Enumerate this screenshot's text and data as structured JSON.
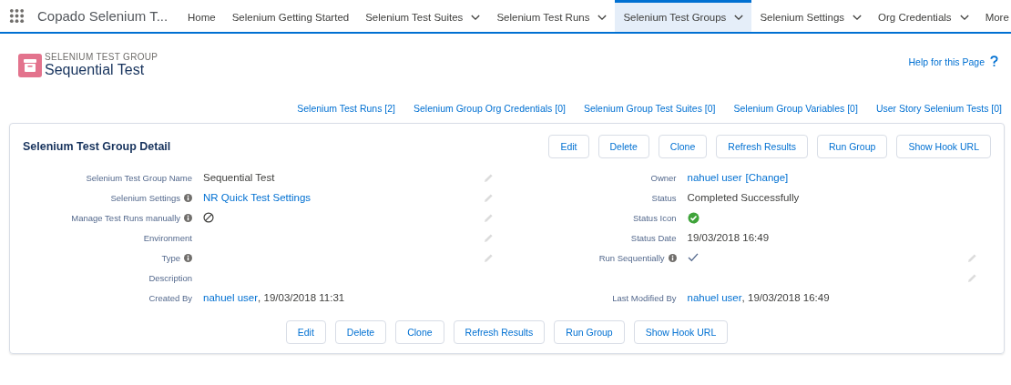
{
  "app": {
    "name": "Copado Selenium T..."
  },
  "nav": [
    {
      "label": "Home",
      "kind": "link",
      "selected": false
    },
    {
      "label": "Selenium Getting Started",
      "kind": "link",
      "selected": false
    },
    {
      "label": "Selenium Test Suites",
      "kind": "dropdown",
      "selected": false
    },
    {
      "label": "Selenium Test Runs",
      "kind": "dropdown",
      "selected": false
    },
    {
      "label": "Selenium Test Groups",
      "kind": "dropdown",
      "selected": true
    },
    {
      "label": "Selenium Settings",
      "kind": "dropdown",
      "selected": false
    },
    {
      "label": "Org Credentials",
      "kind": "dropdown",
      "selected": false
    },
    {
      "label": "More",
      "kind": "overflow",
      "selected": false
    }
  ],
  "header": {
    "object_type": "SELENIUM TEST GROUP",
    "record_name": "Sequential Test",
    "help_link": "Help for this Page"
  },
  "related_links": [
    "Selenium Test Runs [2]",
    "Selenium Group Org Credentials [0]",
    "Selenium Group Test Suites [0]",
    "Selenium Group Variables [0]",
    "User Story Selenium Tests [0]"
  ],
  "detail": {
    "title": "Selenium Test Group Detail",
    "top_buttons": [
      "Edit",
      "Delete",
      "Clone",
      "Refresh Results",
      "Run Group",
      "Show Hook URL"
    ],
    "rows": [
      {
        "kind": "pair",
        "left": {
          "label": "Selenium Test Group Name",
          "info": false,
          "editable": true,
          "kind": "text",
          "parts": [
            {
              "text": "Sequential Test",
              "kind": "text"
            }
          ]
        },
        "right": {
          "label": "Owner",
          "info": false,
          "editable": false,
          "kind": "text",
          "parts": [
            {
              "text": "nahuel user",
              "kind": "link"
            },
            {
              "text": "[Change]",
              "kind": "link"
            }
          ]
        }
      },
      {
        "kind": "pair",
        "left": {
          "label": "Selenium Settings",
          "info": true,
          "editable": true,
          "kind": "text",
          "parts": [
            {
              "text": "NR Quick Test Settings",
              "kind": "link"
            }
          ]
        },
        "right": {
          "label": "Status",
          "info": false,
          "editable": false,
          "kind": "text",
          "parts": [
            {
              "text": "Completed Successfully",
              "kind": "text"
            }
          ]
        }
      },
      {
        "kind": "pair",
        "left": {
          "label": "Manage Test Runs manually",
          "info": true,
          "editable": true,
          "kind": "checkbox",
          "checked": false
        },
        "right": {
          "label": "Status Icon",
          "info": false,
          "editable": false,
          "kind": "status_icon"
        }
      },
      {
        "kind": "pair",
        "left": {
          "label": "Environment",
          "info": false,
          "editable": true,
          "kind": "text"
        },
        "right": {
          "label": "Status Date",
          "info": false,
          "editable": false,
          "kind": "text",
          "parts": [
            {
              "text": "19/03/2018 16:49",
              "kind": "text"
            }
          ]
        }
      },
      {
        "kind": "pair",
        "left": {
          "label": "Type",
          "info": true,
          "editable": true,
          "kind": "text"
        },
        "right": {
          "label": "Run Sequentially",
          "info": true,
          "editable": true,
          "kind": "checkbox",
          "checked": true
        }
      },
      {
        "kind": "wide",
        "left": {
          "label": "Description",
          "info": false,
          "editable": true,
          "kind": "text"
        }
      },
      {
        "kind": "pair",
        "left": {
          "label": "Created By",
          "info": false,
          "editable": false,
          "kind": "text",
          "parts": [
            {
              "text": "nahuel user",
              "kind": "link"
            },
            {
              "text": ", 19/03/2018 11:31",
              "kind": "text"
            }
          ]
        },
        "right": {
          "label": "Last Modified By",
          "info": false,
          "editable": false,
          "kind": "text",
          "parts": [
            {
              "text": "nahuel user",
              "kind": "link"
            },
            {
              "text": ", 19/03/2018 16:49",
              "kind": "text"
            }
          ]
        }
      }
    ],
    "bottom_buttons": [
      "Edit",
      "Delete",
      "Clone",
      "Refresh Results",
      "Run Group",
      "Show Hook URL"
    ]
  }
}
